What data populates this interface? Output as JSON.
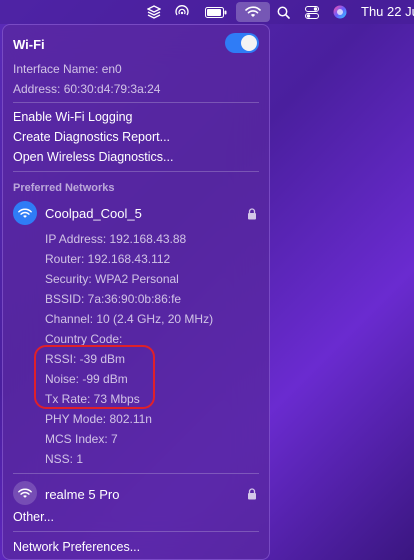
{
  "menubar": {
    "clock": "Thu 22 Ju"
  },
  "wifi": {
    "title": "Wi-Fi",
    "toggle_on": true,
    "interface_name": "Interface Name: en0",
    "address": "Address: 60:30:d4:79:3a:24"
  },
  "actions": {
    "enable_logging": "Enable Wi-Fi Logging",
    "create_report": "Create Diagnostics Report...",
    "open_diagnostics": "Open Wireless Diagnostics..."
  },
  "preferred": {
    "heading": "Preferred Networks",
    "active_network": {
      "name": "Coolpad_Cool_5",
      "details": [
        "IP Address: 192.168.43.88",
        "Router: 192.168.43.112",
        "Security: WPA2 Personal",
        "BSSID: 7a:36:90:0b:86:fe",
        "Channel: 10 (2.4 GHz, 20 MHz)",
        "Country Code:",
        "RSSI: -39 dBm",
        "Noise: -99 dBm",
        "Tx Rate: 73 Mbps",
        "PHY Mode: 802.11n",
        "MCS Index: 7",
        "NSS: 1"
      ]
    },
    "other_network": {
      "name": "realme 5 Pro"
    }
  },
  "footer": {
    "other": "Other...",
    "network_prefs": "Network Preferences..."
  },
  "colors": {
    "accent": "#2f7cf6",
    "highlight": "#e0202a"
  }
}
